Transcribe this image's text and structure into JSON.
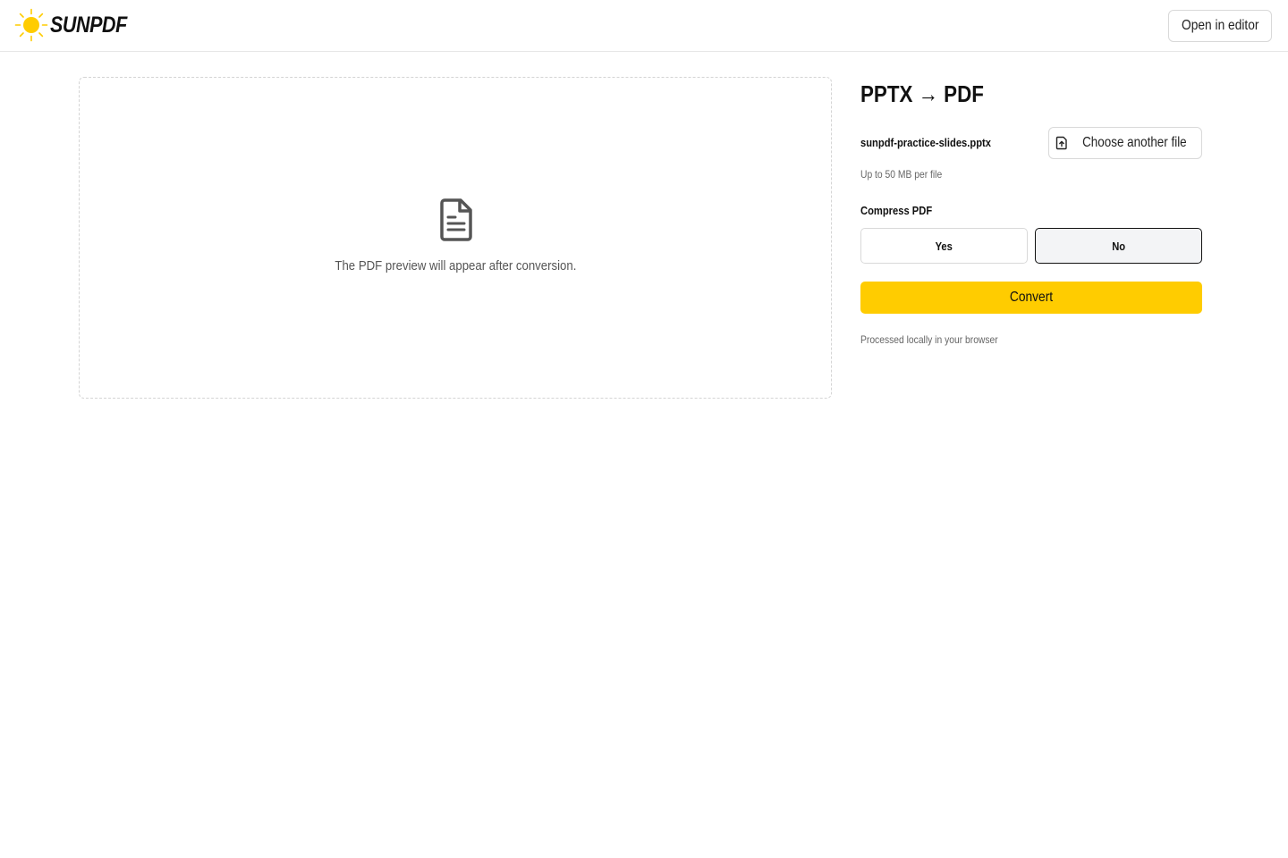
{
  "header": {
    "brand": "SUNPDF",
    "brand_icon": "sun-icon",
    "brand_color": "#ffcc00",
    "open_editor_label": "Open in editor"
  },
  "preview": {
    "icon": "document-icon",
    "message": "The PDF preview will appear after conversion."
  },
  "panel": {
    "title": "PPTX → PDF",
    "file_name": "sunpdf-practice-slides.pptx",
    "choose_another_label": "Choose another file",
    "choose_another_icon": "file-upload-icon",
    "size_limit": "Up to 50 MB per file",
    "compress_label": "Compress PDF",
    "compress_options": [
      "Yes",
      "No"
    ],
    "compress_selected": "No",
    "convert_label": "Convert",
    "convert_color": "#ffcc00",
    "footer_note": "Processed locally in your browser"
  }
}
